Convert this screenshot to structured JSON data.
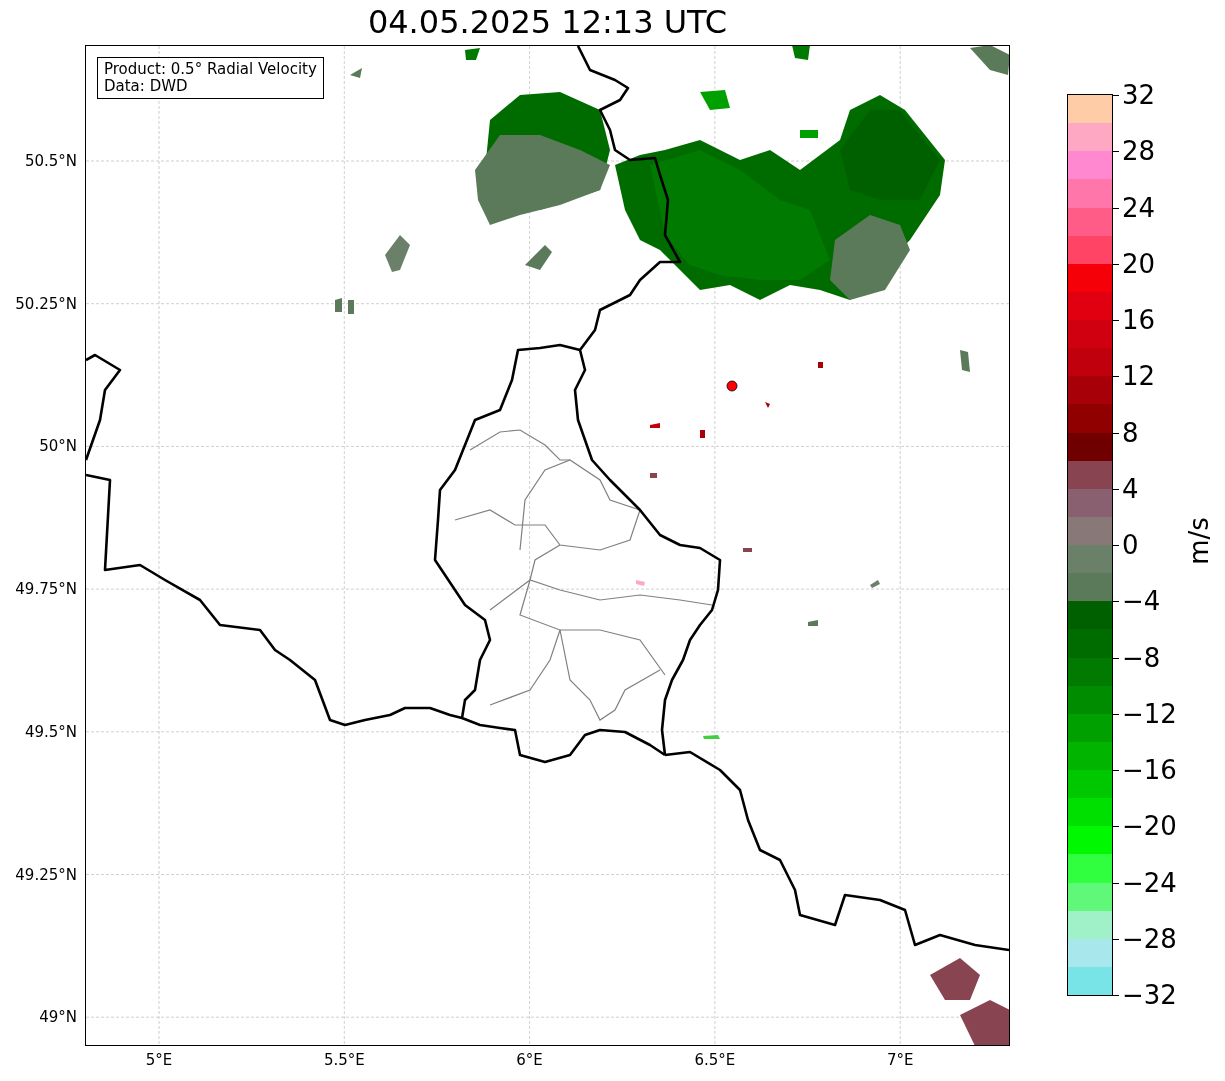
{
  "title": "04.05.2025 12:13 UTC",
  "info_box": {
    "lines": [
      "Product: 0.5° Radial Velocity",
      "Data: DWD"
    ]
  },
  "map": {
    "x_ticks": [
      "5°E",
      "5.5°E",
      "6°E",
      "6.5°E",
      "7°E"
    ],
    "y_ticks": [
      "50.5°N",
      "50.25°N",
      "50°N",
      "49.75°N",
      "49.5°N",
      "49.25°N",
      "49°N"
    ]
  },
  "colorbar": {
    "label": "m/s",
    "ticks": [
      "32",
      "28",
      "24",
      "20",
      "16",
      "12",
      "8",
      "4",
      "0",
      "−4",
      "−8",
      "−12",
      "−16",
      "−20",
      "−24",
      "−28",
      "−32"
    ],
    "bins": [
      {
        "color": "#ffcca8"
      },
      {
        "color": "#ffa8c4"
      },
      {
        "color": "#ff88d0"
      },
      {
        "color": "#ff77aa"
      },
      {
        "color": "#ff5c88"
      },
      {
        "color": "#ff4466"
      },
      {
        "color": "#f50008"
      },
      {
        "color": "#e00010"
      },
      {
        "color": "#d00010"
      },
      {
        "color": "#c0000c"
      },
      {
        "color": "#a80008"
      },
      {
        "color": "#900000"
      },
      {
        "color": "#700000"
      },
      {
        "color": "#884450"
      },
      {
        "color": "#886070"
      },
      {
        "color": "#887878"
      },
      {
        "color": "#6a8068"
      },
      {
        "color": "#5a7a5a"
      },
      {
        "color": "#006000"
      },
      {
        "color": "#006c00"
      },
      {
        "color": "#007a00"
      },
      {
        "color": "#008c00"
      },
      {
        "color": "#00a000"
      },
      {
        "color": "#00b400"
      },
      {
        "color": "#00c800"
      },
      {
        "color": "#00e000"
      },
      {
        "color": "#00f800"
      },
      {
        "color": "#30ff40"
      },
      {
        "color": "#60f878"
      },
      {
        "color": "#a0f0c8"
      },
      {
        "color": "#a8e8ec"
      },
      {
        "color": "#78e4e8"
      }
    ]
  }
}
